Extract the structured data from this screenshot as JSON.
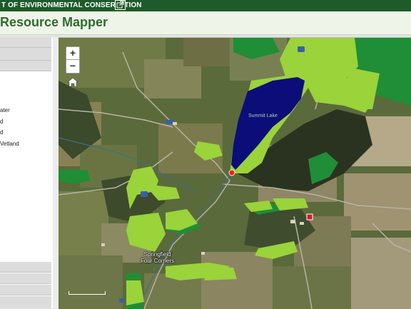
{
  "header": {
    "agency_text": "T OF ENVIRONMENTAL CONSERVATION",
    "external_link_icon": "external-link-icon",
    "app_title": "Resource Mapper"
  },
  "left_panel": {
    "legend_items": [
      "ater",
      "d",
      "d",
      "Vetland"
    ]
  },
  "map": {
    "zoom_in": "+",
    "zoom_out": "−",
    "home_icon": "home-icon",
    "lake_label": "Summit Lake",
    "town_label_line1": "Springfield",
    "town_label_line2": "Four Corners",
    "colors": {
      "wetland_light": "#9ad33a",
      "wetland_dark": "#1f8e37",
      "lake": "#0d0d7a",
      "marker": "#ff1a1a"
    }
  }
}
